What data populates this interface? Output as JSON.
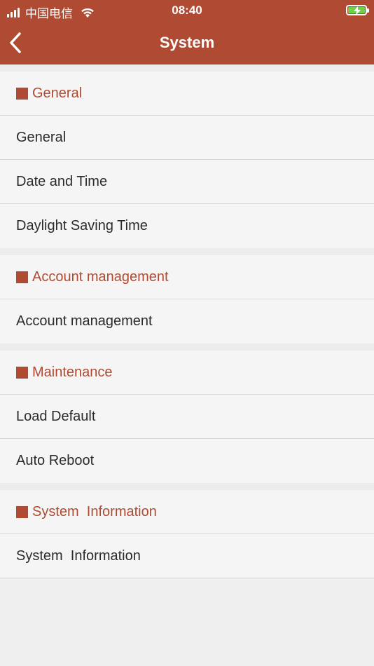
{
  "status_bar": {
    "carrier": "中国电信",
    "time": "08:40"
  },
  "header": {
    "title": "System",
    "back_icon": "chevron-left-icon"
  },
  "colors": {
    "accent": "#b04b33",
    "background": "#f5f5f5",
    "battery": "#6fd04a"
  },
  "sections": [
    {
      "header": "General",
      "items": [
        "General",
        "Date and Time",
        "Daylight Saving Time"
      ]
    },
    {
      "header": "Account management",
      "items": [
        "Account management"
      ]
    },
    {
      "header": "Maintenance",
      "items": [
        "Load Default",
        "Auto Reboot"
      ]
    },
    {
      "header": "System  Information",
      "items": [
        "System  Information"
      ]
    }
  ]
}
